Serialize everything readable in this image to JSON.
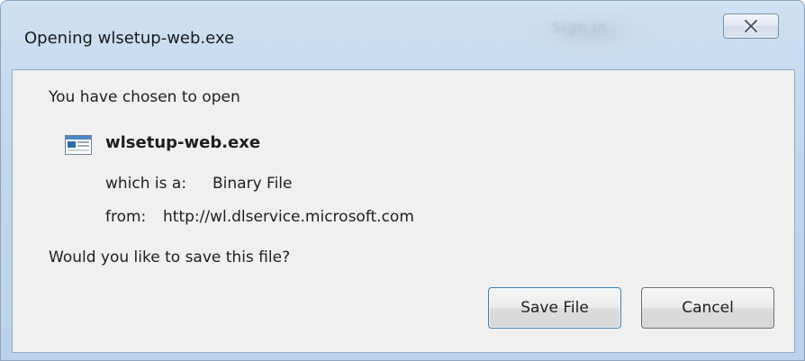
{
  "window": {
    "title": "Opening wlsetup-web.exe",
    "background_text": "Sign in"
  },
  "dialog": {
    "intro": "You have chosen to open",
    "file_name": "wlsetup-web.exe",
    "which_is_label": "which is a:",
    "which_is_value": "Binary File",
    "from_label": "from:",
    "from_value": "http://wl.dlservice.microsoft.com",
    "question": "Would you like to save this file?"
  },
  "buttons": {
    "save_label": "Save File",
    "cancel_label": "Cancel"
  },
  "icons": {
    "close": "close-icon",
    "file": "application-file-icon"
  },
  "colors": {
    "title_bar": "#c1d6ec",
    "client_bg": "#f0f0f0",
    "close_glyph": "#4a5768",
    "default_button_border": "#3c7fb1"
  }
}
